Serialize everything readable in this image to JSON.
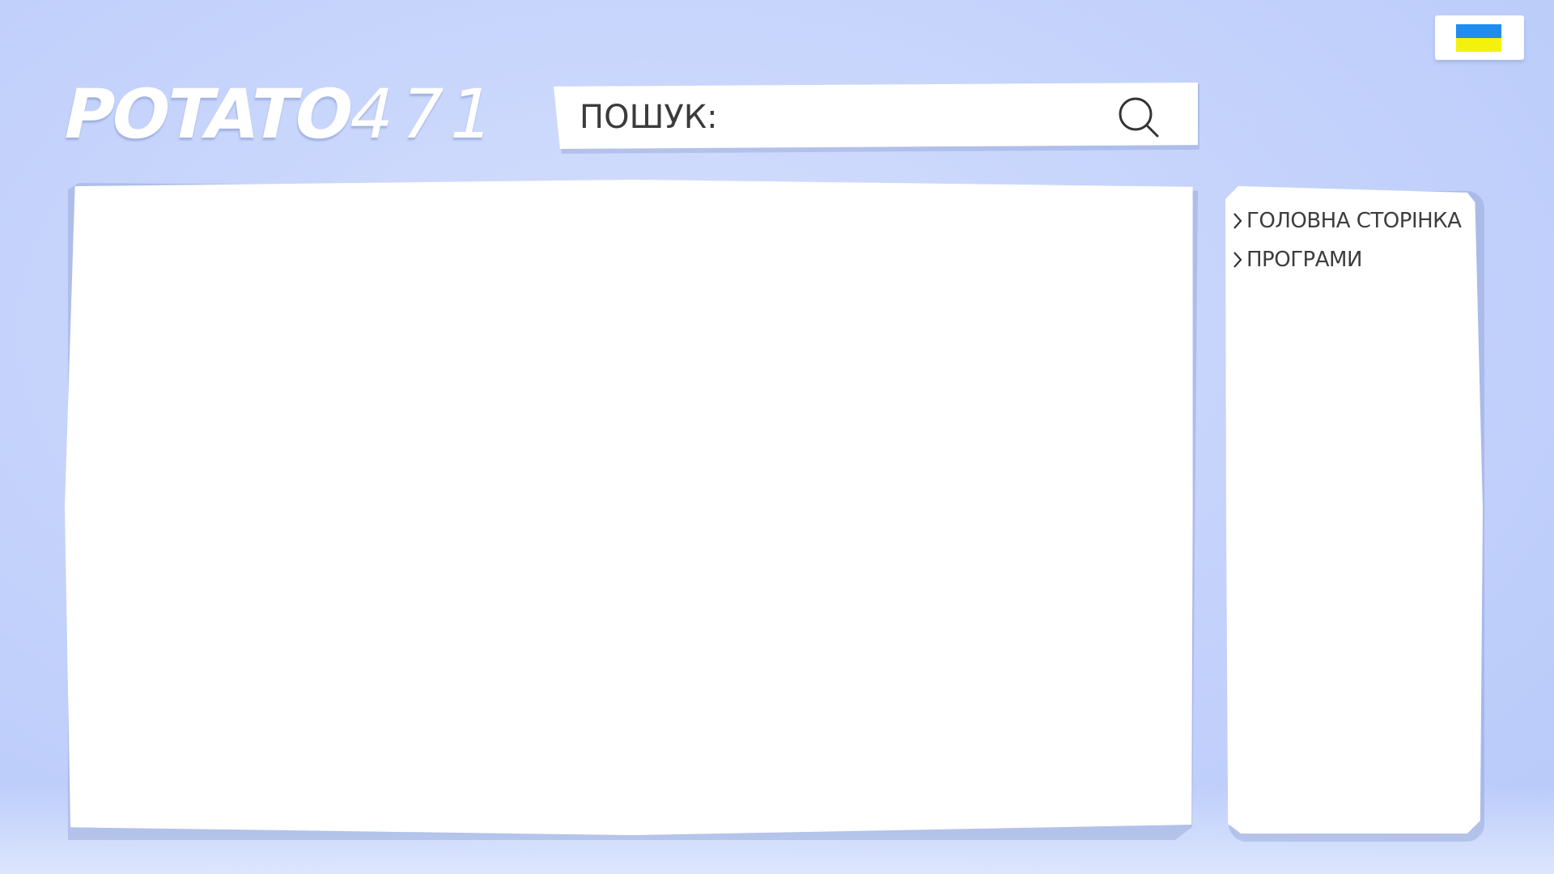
{
  "header": {
    "logo": {
      "bold": "POTATO",
      "light": "471"
    },
    "search": {
      "label": "ПОШУК:",
      "icon": "search-icon"
    }
  },
  "language": {
    "icon": "ukraine-flag-icon",
    "colors": {
      "top": "#1f8cf0",
      "bottom": "#f4f20c"
    }
  },
  "sidebar": {
    "items": [
      {
        "label": "ГОЛОВНА СТОРІНКА",
        "icon": "chevron-right-icon"
      },
      {
        "label": "ПРОГРАМИ",
        "icon": "chevron-right-icon"
      }
    ]
  },
  "colors": {
    "background": "#c9d6fc",
    "panel": "#ffffff",
    "text": "#3d3d3d"
  }
}
